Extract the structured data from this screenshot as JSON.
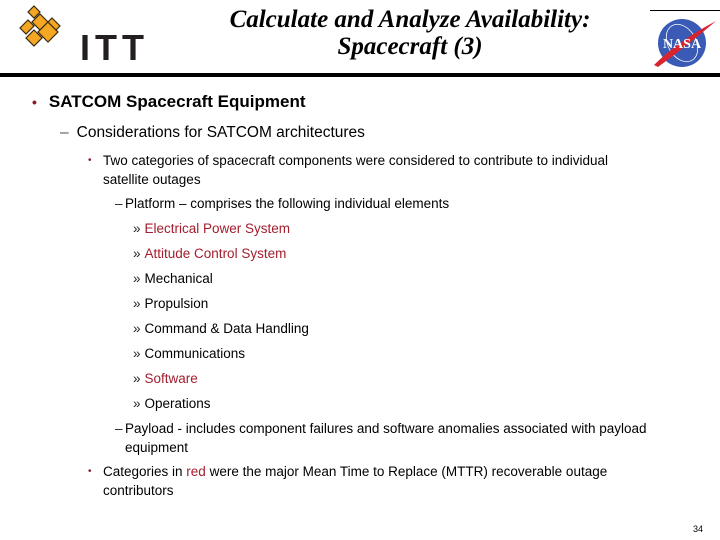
{
  "header": {
    "title_line1": "Calculate and Analyze Availability:",
    "title_line2": "Spacecraft (3)",
    "left_logo": {
      "name": "itt-logo",
      "text": "ITT",
      "color": "#f5a623"
    },
    "right_logo": {
      "name": "nasa-logo",
      "text": "NASA",
      "color": "#3a5bb5",
      "accent": "#d9232e"
    }
  },
  "bullets": {
    "level1": {
      "bullet": "•",
      "text": "SATCOM Spacecraft Equipment"
    },
    "level2": {
      "bullet": "–",
      "text": "Considerations for SATCOM architectures"
    },
    "level3_a": {
      "bullet": "•",
      "text": "Two categories of spacecraft components were considered to contribute to individual satellite outages"
    },
    "platform": {
      "bullet": "–",
      "text": "Platform – comprises the following individual elements"
    },
    "elements": [
      {
        "bullet": "»",
        "text": "Electrical Power System",
        "highlight": true
      },
      {
        "bullet": "»",
        "text": "Attitude Control System",
        "highlight": true
      },
      {
        "bullet": "»",
        "text": "Mechanical",
        "highlight": false
      },
      {
        "bullet": "»",
        "text": "Propulsion",
        "highlight": false
      },
      {
        "bullet": "»",
        "text": "Command & Data Handling",
        "highlight": false
      },
      {
        "bullet": "»",
        "text": "Communications",
        "highlight": false
      },
      {
        "bullet": "»",
        "text": "Software",
        "highlight": true
      },
      {
        "bullet": "»",
        "text": "Operations",
        "highlight": false
      }
    ],
    "payload": {
      "bullet": "–",
      "text": "Payload - includes component failures and software anomalies associated with payload equipment"
    },
    "level3_b": {
      "bullet": "•",
      "text_before": "Categories in ",
      "text_red": "red",
      "text_after": " were the major Mean Time to Replace (MTTR) recoverable outage contributors"
    }
  },
  "colors": {
    "highlight": "#a31d2d",
    "bullet": "#8b1a2a"
  },
  "footer": {
    "page_number": "34"
  }
}
